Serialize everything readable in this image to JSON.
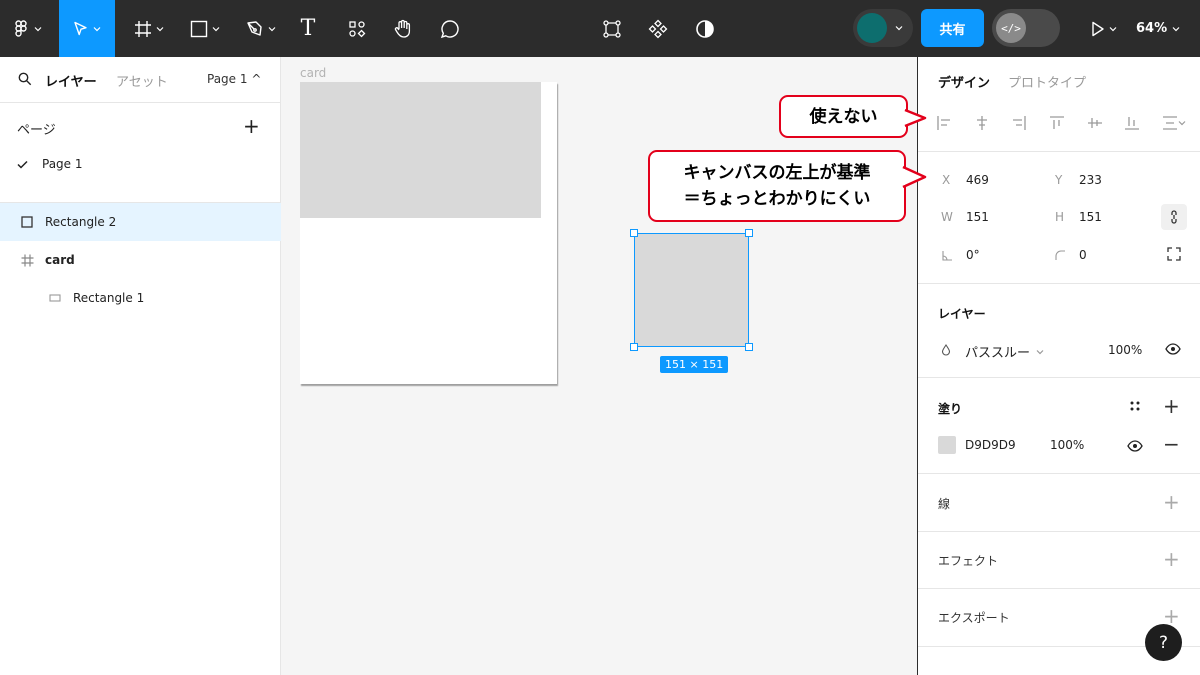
{
  "toolbar": {
    "tools": [
      {
        "name": "figma-menu-icon"
      },
      {
        "name": "move-tool-icon",
        "active": true
      },
      {
        "name": "frame-tool-icon"
      },
      {
        "name": "shape-tool-icon"
      },
      {
        "name": "pen-tool-icon"
      },
      {
        "name": "text-tool-icon",
        "glyph": "T"
      },
      {
        "name": "components-icon"
      },
      {
        "name": "hand-tool-icon"
      },
      {
        "name": "comment-tool-icon"
      }
    ],
    "center_icons": [
      "component-edit-icon",
      "component-diamond-icon",
      "contrast-icon"
    ],
    "share_label": "共有",
    "dev_mode_glyph": "</>",
    "zoom": "64%",
    "accent_color": "#0d99ff",
    "avatar_color": "#0d6e6e"
  },
  "left_panel": {
    "tab_layers": "レイヤー",
    "tab_assets": "アセット",
    "page_selector": "Page 1 ^",
    "pages_heading": "ページ",
    "add_glyph": "+",
    "pages": [
      {
        "label": "Page 1",
        "checked": true
      }
    ],
    "layers": [
      {
        "label": "Rectangle 2",
        "selected": true,
        "icon": "rectangle-icon"
      },
      {
        "label": "card",
        "selected": false,
        "icon": "frame-icon"
      },
      {
        "label": "Rectangle 1",
        "selected": false,
        "icon": "rectangle-icon",
        "indent": 1
      }
    ]
  },
  "canvas": {
    "frame_label": "card",
    "selection_size": "151 × 151"
  },
  "right_panel": {
    "tab_design": "デザイン",
    "tab_prototype": "プロトタイプ",
    "position": {
      "x_label": "X",
      "x": "469",
      "y_label": "Y",
      "y": "233"
    },
    "size": {
      "w_label": "W",
      "w": "151",
      "h_label": "H",
      "h": "151"
    },
    "rotation": "0°",
    "corner_radius": "0",
    "layer_section": {
      "title": "レイヤー",
      "blend_mode": "パススルー",
      "opacity": "100%"
    },
    "fill_section": {
      "title": "塗り",
      "color_hex": "D9D9D9",
      "opacity": "100%",
      "color": "#d9d9d9"
    },
    "stroke_title": "線",
    "effects_title": "エフェクト",
    "export_title": "エクスポート",
    "add_glyph": "+",
    "remove_glyph": "−",
    "help_glyph": "?"
  },
  "callouts": {
    "unusable": "使えない",
    "canvas_basis_line1": "キャンバスの左上が基準",
    "canvas_basis_line2": "＝ちょっとわかりにくい",
    "border_color": "#e3001b"
  }
}
